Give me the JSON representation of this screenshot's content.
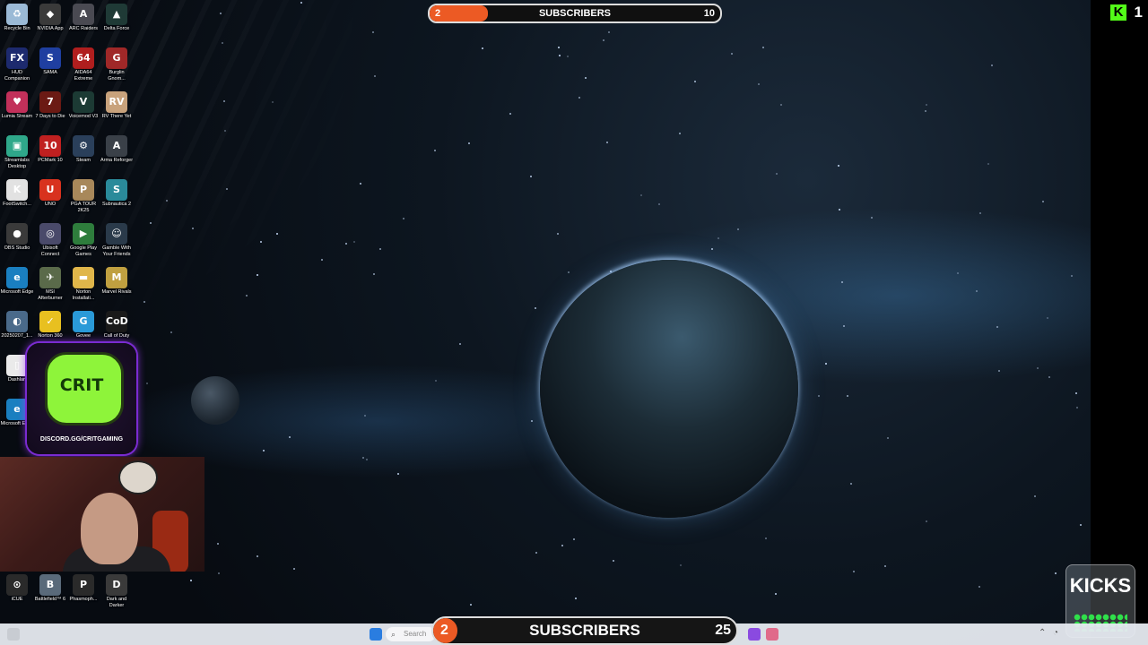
{
  "desktop_icons": [
    {
      "label": "Recycle Bin",
      "icon": "recycle-bin-icon",
      "color": "#9bbad6",
      "glyph": "♻"
    },
    {
      "label": "NVIDIA App",
      "icon": "nvidia-icon",
      "color": "#3a3a3a",
      "glyph": "◆"
    },
    {
      "label": "ARC Raiders",
      "icon": "arc-raiders-icon",
      "color": "#4a4a52",
      "glyph": "A"
    },
    {
      "label": "Delta Force",
      "icon": "delta-force-icon",
      "color": "#1f3a36",
      "glyph": "▲"
    },
    {
      "label": "HUD Companion",
      "icon": "hud-companion-icon",
      "color": "#1d2a6e",
      "glyph": "FX"
    },
    {
      "label": "SAMA",
      "icon": "sama-icon",
      "color": "#1f3fa0",
      "glyph": "S"
    },
    {
      "label": "AIDA64 Extreme",
      "icon": "aida64-icon",
      "color": "#b01e1e",
      "glyph": "64"
    },
    {
      "label": "Burglin Gnom...",
      "icon": "burglin-gnomes-icon",
      "color": "#a02828",
      "glyph": "G"
    },
    {
      "label": "Lumia Stream",
      "icon": "lumia-stream-icon",
      "color": "#c2305a",
      "glyph": "♥"
    },
    {
      "label": "7 Days to Die",
      "icon": "7-days-to-die-icon",
      "color": "#6b1a14",
      "glyph": "7"
    },
    {
      "label": "Voicemod V3",
      "icon": "voicemod-icon",
      "color": "#1c3a34",
      "glyph": "V"
    },
    {
      "label": "RV There Yet",
      "icon": "rv-there-yet-icon",
      "color": "#c8a27c",
      "glyph": "RV"
    },
    {
      "label": "Streamlabs Desktop",
      "icon": "streamlabs-icon",
      "color": "#2fa88a",
      "glyph": "▣"
    },
    {
      "label": "PCMark 10",
      "icon": "pcmark-icon",
      "color": "#c02020",
      "glyph": "10"
    },
    {
      "label": "Steam",
      "icon": "steam-icon",
      "color": "#2a3f5a",
      "glyph": "⚙"
    },
    {
      "label": "Arma Reforger",
      "icon": "arma-reforger-icon",
      "color": "#3a4048",
      "glyph": "A"
    },
    {
      "label": "FootSwitch...",
      "icon": "footswitch-icon",
      "color": "#e2e2e2",
      "glyph": "K"
    },
    {
      "label": "UNO",
      "icon": "uno-icon",
      "color": "#d8321e",
      "glyph": "U"
    },
    {
      "label": "PGA TOUR 2K25",
      "icon": "pga-tour-icon",
      "color": "#a8885a",
      "glyph": "P"
    },
    {
      "label": "Subnautica 2",
      "icon": "subnautica-icon",
      "color": "#2a8a9a",
      "glyph": "S"
    },
    {
      "label": "OBS Studio",
      "icon": "obs-studio-icon",
      "color": "#3a3a3a",
      "glyph": "●"
    },
    {
      "label": "Ubisoft Connect",
      "icon": "ubisoft-connect-icon",
      "color": "#4a4a6a",
      "glyph": "◎"
    },
    {
      "label": "Google Play Games",
      "icon": "google-play-games-icon",
      "color": "#2e7d3c",
      "glyph": "▶"
    },
    {
      "label": "Gamble With Your Friends",
      "icon": "gamble-with-friends-icon",
      "color": "#2a3a4a",
      "glyph": "☺"
    },
    {
      "label": "Microsoft Edge",
      "icon": "microsoft-edge-icon",
      "color": "#1a7fc0",
      "glyph": "e"
    },
    {
      "label": "MSI Afterburner",
      "icon": "msi-afterburner-icon",
      "color": "#5a6a4a",
      "glyph": "✈"
    },
    {
      "label": "Norton Installati...",
      "icon": "folder-icon",
      "color": "#e0b64a",
      "glyph": "▬"
    },
    {
      "label": "Marvel Rivals",
      "icon": "marvel-rivals-icon",
      "color": "#c0a040",
      "glyph": "M"
    },
    {
      "label": "20250207_1...",
      "icon": "image-file-icon",
      "color": "#4a6a8a",
      "glyph": "◐"
    },
    {
      "label": "Norton 360",
      "icon": "norton-360-icon",
      "color": "#e8c020",
      "glyph": "✓"
    },
    {
      "label": "Govee",
      "icon": "govee-icon",
      "color": "#2a9ad8",
      "glyph": "G"
    },
    {
      "label": "Call of Duty",
      "icon": "call-of-duty-icon",
      "color": "#1a1a1a",
      "glyph": "CoD"
    },
    {
      "label": "Dashlan",
      "icon": "dashlane-icon",
      "color": "#eaeaea",
      "glyph": "▯"
    },
    {
      "label": "Microsoft Edge",
      "icon": "microsoft-edge-icon-2",
      "color": "#1a7fc0",
      "glyph": "e"
    },
    {
      "label": "iCUE",
      "icon": "icue-icon",
      "color": "#2a2a2a",
      "glyph": "⊙"
    },
    {
      "label": "Battlefield™ 6",
      "icon": "battlefield-6-icon",
      "color": "#5a6a7a",
      "glyph": "B"
    },
    {
      "label": "Phasmoph...",
      "icon": "phasmophobia-icon",
      "color": "#2a2a2a",
      "glyph": "P"
    },
    {
      "label": "Dark and Darker",
      "icon": "dark-and-darker-icon",
      "color": "#3a3a3a",
      "glyph": "D"
    }
  ],
  "subscriber_goal_top": {
    "current": "2",
    "label": "SUBSCRIBERS",
    "goal": "10",
    "progress": 0.2,
    "fill_color": "#ec5a24"
  },
  "kick_followers": {
    "logo": "K",
    "count": "1",
    "logo_color": "#53fc18"
  },
  "discord_card": {
    "logo_text": "CRIT",
    "link": "DISCORD.GG/CRITGAMING"
  },
  "kicks_widget": {
    "title": "KICKS"
  },
  "subscriber_goal_bottom": {
    "current": "2",
    "label": "SUBSCRIBERS",
    "goal": "25",
    "progress": 0.08,
    "fill_color": "#ec5a24"
  },
  "taskbar": {
    "search_placeholder": "Search"
  }
}
